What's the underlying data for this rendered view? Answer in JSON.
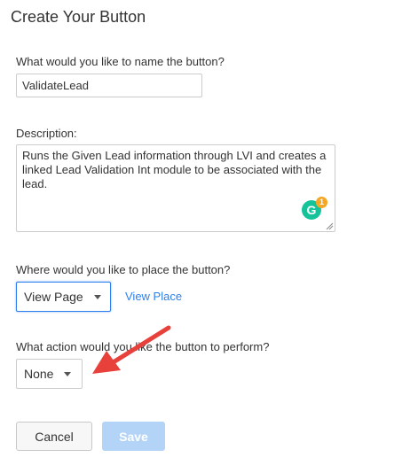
{
  "header": {
    "title": "Create Your Button"
  },
  "name_field": {
    "label": "What would you like to name the button?",
    "value": "ValidateLead"
  },
  "description_field": {
    "label": "Description:",
    "value": "Runs the Given Lead information through LVI and creates a linked Lead Validation Int module to be associated with the lead."
  },
  "grammarly": {
    "icon": "grammarly-icon",
    "letter": "G",
    "badge_count": "1",
    "color": "#15c39a",
    "badge_color": "#f5a623"
  },
  "placement": {
    "label": "Where would you like to place the button?",
    "selected": "View Page",
    "link_label": "View Place"
  },
  "action": {
    "label": "What action would you like the button to perform?",
    "selected": "None"
  },
  "buttons": {
    "cancel_label": "Cancel",
    "save_label": "Save"
  },
  "annotation": {
    "arrow_color": "#e8403a"
  },
  "colors": {
    "accent": "#2f80ed",
    "save_disabled": "#b3d4f7"
  }
}
